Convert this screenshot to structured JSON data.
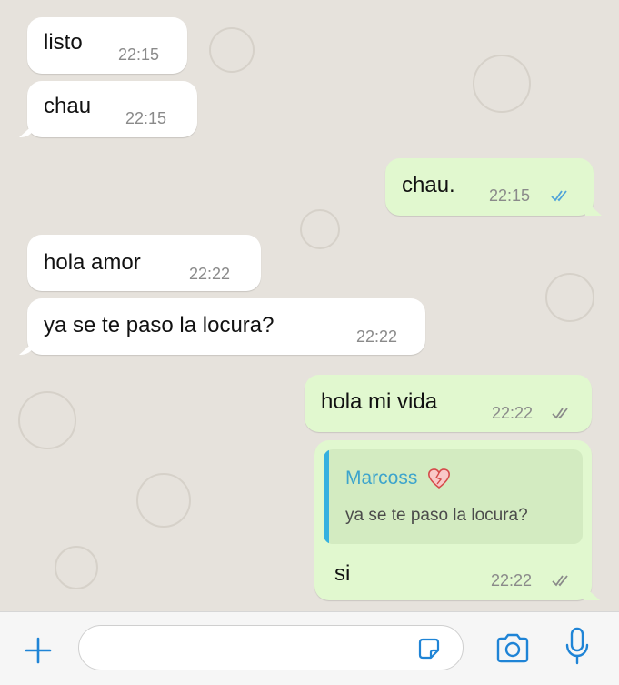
{
  "colors": {
    "incoming_bubble": "#ffffff",
    "outgoing_bubble": "#e1f8cf",
    "read_ticks": "#4fa3d9",
    "sent_ticks": "#8a8a8a",
    "accent": "#1f84d6"
  },
  "messages": [
    {
      "direction": "incoming",
      "text": "listo",
      "time": "22:15"
    },
    {
      "direction": "incoming",
      "text": "chau",
      "time": "22:15"
    },
    {
      "direction": "outgoing",
      "text": "chau.",
      "time": "22:15",
      "status_icon": "double-check-read-icon"
    },
    {
      "direction": "incoming",
      "text": "hola amor",
      "time": "22:22"
    },
    {
      "direction": "incoming",
      "text": "ya se te paso la locura?",
      "time": "22:22"
    },
    {
      "direction": "outgoing",
      "text": "hola mi vida",
      "time": "22:22",
      "status_icon": "double-check-icon"
    },
    {
      "direction": "outgoing",
      "text": "si",
      "time": "22:22",
      "status_icon": "double-check-icon",
      "reply": {
        "author": "Marcoss",
        "author_emoji_icon": "mended-heart-icon",
        "text": "ya se te paso la locura?"
      }
    }
  ],
  "input_bar": {
    "add_icon": "plus-icon",
    "sticker_icon": "sticker-icon",
    "camera_icon": "camera-icon",
    "mic_icon": "microphone-icon",
    "placeholder": ""
  }
}
